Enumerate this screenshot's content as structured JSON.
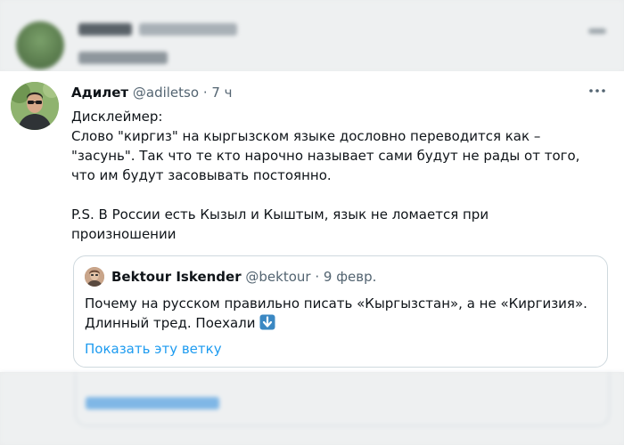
{
  "tweet": {
    "display_name": "Адилет",
    "handle": "@adiletso",
    "separator": "·",
    "time": "7 ч",
    "more_icon": "more-horizontal-icon",
    "lines": [
      "Дисклеймер:",
      "Слово \"киргиз\" на кыргызском языке дословно переводится как –",
      "\"засунь\". Так что те кто нарочно называет сами будут не рады от того,",
      "что им будут засовывать постоянно.",
      "",
      "P.S. В России есть Кызыл и Кыштым, язык не ломается при",
      "произношении"
    ]
  },
  "quoted_tweet": {
    "display_name": "Bektour Iskender",
    "handle": "@bektour",
    "separator": "·",
    "date": "9 февр.",
    "text_line1": "Почему на русском правильно писать «Кыргызстан», а не «Киргизия».",
    "text_line2": "Длинный тред. Поехали",
    "emoji": "arrow-down-emoji",
    "show_thread_link": "Показать эту ветку"
  },
  "colors": {
    "link_blue": "#1d9bf0",
    "secondary_text": "#536471",
    "border": "#cfd9de"
  }
}
